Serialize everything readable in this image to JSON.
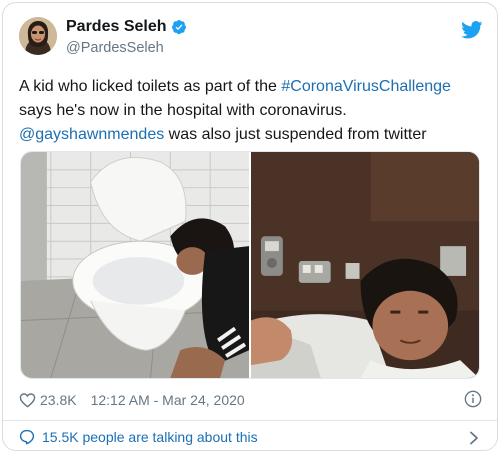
{
  "author": {
    "display_name": "Pardes Seleh",
    "handle": "@PardesSeleh",
    "verified": true
  },
  "tweet": {
    "line1_prefix": "A kid who licked toilets as part of the ",
    "hashtag": "#CoronaVirusChallenge",
    "line2": " says he's now in the hospital with coronavirus.",
    "mention": "@gayshawnmendes",
    "line3_suffix": " was also just suspended from twitter"
  },
  "media": [
    {
      "icon": "photo-toilet"
    },
    {
      "icon": "photo-hospital-selfie"
    }
  ],
  "meta": {
    "like_count": "23.8K",
    "timestamp": "12:12 AM - Mar 24, 2020"
  },
  "conversation": {
    "label": "15.5K people are talking about this"
  },
  "colors": {
    "link": "#1b6fb3",
    "twitter_blue": "#1da1f2",
    "secondary_text": "#657786"
  }
}
